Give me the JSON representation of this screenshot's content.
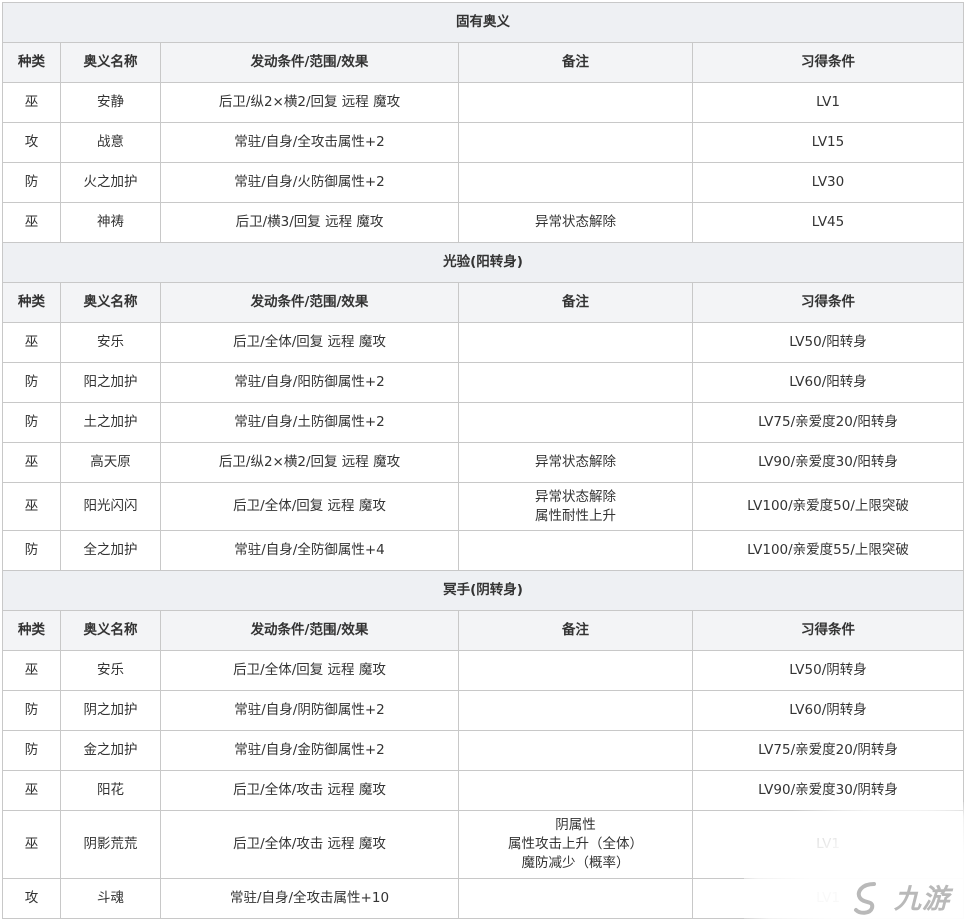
{
  "headers": [
    "种类",
    "奥义名称",
    "发动条件/范围/效果",
    "备注",
    "习得条件"
  ],
  "sections": [
    {
      "title": "固有奥义",
      "rows": [
        {
          "type": "巫",
          "name": "安静",
          "effect": "后卫/纵2×横2/回复 远程 魔攻",
          "note": [],
          "req": "LV1"
        },
        {
          "type": "攻",
          "name": "战意",
          "effect": "常驻/自身/全攻击属性+2",
          "note": [],
          "req": "LV15"
        },
        {
          "type": "防",
          "name": "火之加护",
          "effect": "常驻/自身/火防御属性+2",
          "note": [],
          "req": "LV30"
        },
        {
          "type": "巫",
          "name": "神祷",
          "effect": "后卫/横3/回复 远程 魔攻",
          "note": [
            "异常状态解除"
          ],
          "req": "LV45"
        }
      ]
    },
    {
      "title": "光验(阳转身)",
      "rows": [
        {
          "type": "巫",
          "name": "安乐",
          "effect": "后卫/全体/回复 远程 魔攻",
          "note": [],
          "req": "LV50/阳转身"
        },
        {
          "type": "防",
          "name": "阳之加护",
          "effect": "常驻/自身/阳防御属性+2",
          "note": [],
          "req": "LV60/阳转身"
        },
        {
          "type": "防",
          "name": "土之加护",
          "effect": "常驻/自身/土防御属性+2",
          "note": [],
          "req": "LV75/亲爱度20/阳转身"
        },
        {
          "type": "巫",
          "name": "高天原",
          "effect": "后卫/纵2×横2/回复 远程 魔攻",
          "note": [
            "异常状态解除"
          ],
          "req": "LV90/亲爱度30/阳转身"
        },
        {
          "type": "巫",
          "name": "阳光闪闪",
          "effect": "后卫/全体/回复 远程 魔攻",
          "note": [
            "异常状态解除",
            "属性耐性上升"
          ],
          "req": "LV100/亲爱度50/上限突破"
        },
        {
          "type": "防",
          "name": "全之加护",
          "effect": "常驻/自身/全防御属性+4",
          "note": [],
          "req": "LV100/亲爱度55/上限突破"
        }
      ]
    },
    {
      "title": "冥手(阴转身)",
      "rows": [
        {
          "type": "巫",
          "name": "安乐",
          "effect": "后卫/全体/回复 远程 魔攻",
          "note": [],
          "req": "LV50/阴转身"
        },
        {
          "type": "防",
          "name": "阴之加护",
          "effect": "常驻/自身/阴防御属性+2",
          "note": [],
          "req": "LV60/阴转身"
        },
        {
          "type": "防",
          "name": "金之加护",
          "effect": "常驻/自身/金防御属性+2",
          "note": [],
          "req": "LV75/亲爱度20/阴转身"
        },
        {
          "type": "巫",
          "name": "阳花",
          "effect": "后卫/全体/攻击 远程 魔攻",
          "note": [],
          "req": "LV90/亲爱度30/阴转身"
        },
        {
          "type": "巫",
          "name": "阴影荒荒",
          "effect": "后卫/全体/攻击 远程 魔攻",
          "note": [
            "阴属性",
            "属性攻击上升（全体）",
            "魔防减少（概率）"
          ],
          "req": "LV1"
        },
        {
          "type": "攻",
          "name": "斗魂",
          "effect": "常驻/自身/全攻击属性+10",
          "note": [],
          "req": "LV1"
        }
      ]
    }
  ],
  "watermark": {
    "text": "九游",
    "icon": "jiuyou-logo-icon"
  }
}
